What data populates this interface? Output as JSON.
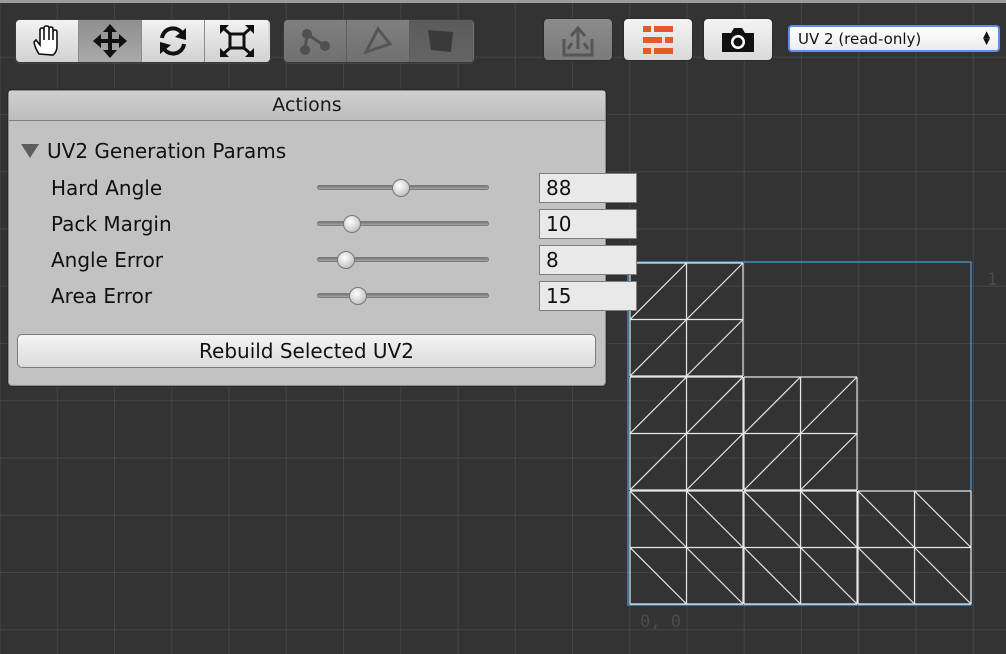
{
  "toolbar": {
    "tools": [
      {
        "icon": "hand-icon",
        "active": false
      },
      {
        "icon": "move-icon",
        "active": true
      },
      {
        "icon": "rotate-icon",
        "active": false
      },
      {
        "icon": "scale-icon",
        "active": false
      }
    ],
    "select_modes": [
      {
        "icon": "vertex-mode-icon",
        "active": false
      },
      {
        "icon": "edge-mode-icon",
        "active": false
      },
      {
        "icon": "face-mode-icon",
        "active": true
      }
    ],
    "actions": [
      {
        "icon": "export-icon"
      },
      {
        "icon": "layout-icon",
        "accent": "#e45a2c"
      },
      {
        "icon": "camera-icon"
      }
    ],
    "channel_dropdown": {
      "selected": "UV 2 (read-only)"
    }
  },
  "actions_panel": {
    "title": "Actions",
    "section_title": "UV2 Generation Params",
    "params": [
      {
        "label": "Hard Angle",
        "value": "88",
        "slider_fraction": 0.49
      },
      {
        "label": "Pack Margin",
        "value": "10",
        "slider_fraction": 0.17
      },
      {
        "label": "Angle Error",
        "value": "8",
        "slider_fraction": 0.13
      },
      {
        "label": "Area Error",
        "value": "15",
        "slider_fraction": 0.21
      }
    ],
    "rebuild_label": "Rebuild Selected UV2"
  },
  "canvas": {
    "origin_label": "0, 0",
    "corner_label": "1",
    "selection_color": "#4a9fd6"
  }
}
